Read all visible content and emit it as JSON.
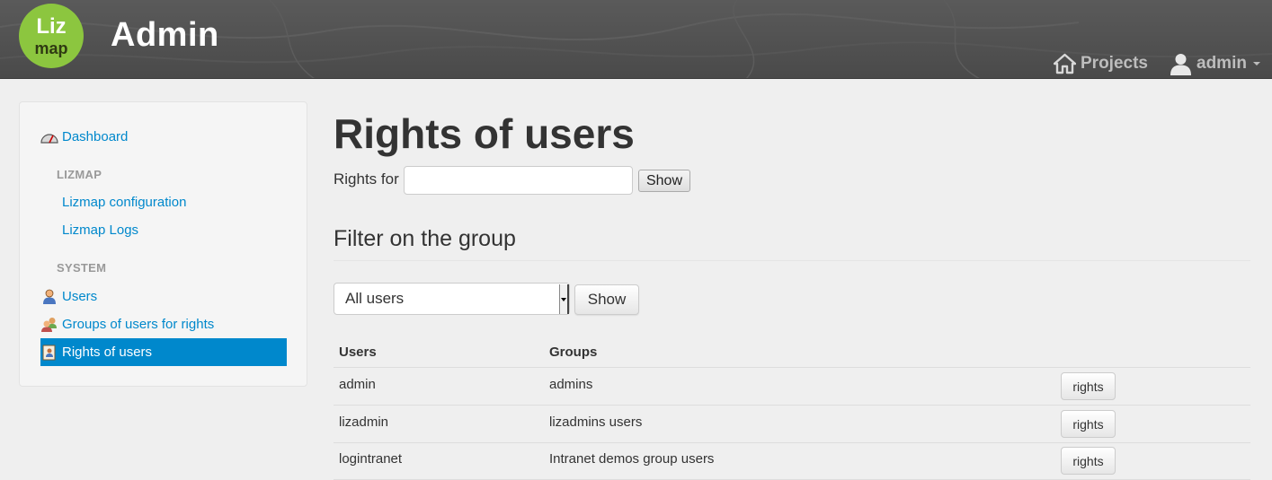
{
  "header": {
    "brand": "Admin",
    "logo_text_top": "Liz",
    "logo_text_bottom": "map",
    "projects_label": "Projects",
    "user_label": "admin"
  },
  "sidebar": {
    "dashboard": "Dashboard",
    "section_lizmap": "LIZMAP",
    "lizmap_configuration": "Lizmap configuration",
    "lizmap_logs": "Lizmap Logs",
    "section_system": "SYSTEM",
    "users": "Users",
    "groups": "Groups of users for rights",
    "rights": "Rights of users"
  },
  "main": {
    "title": "Rights of users",
    "rights_for_label": "Rights for",
    "rights_for_value": "",
    "show_button": "Show",
    "filter_title": "Filter on the group",
    "group_select_value": "All users",
    "filter_show_button": "Show",
    "table": {
      "headers": [
        "Users",
        "Groups"
      ],
      "rows": [
        {
          "user": "admin",
          "groups": "admins",
          "action": "rights"
        },
        {
          "user": "lizadmin",
          "groups": "lizadmins users",
          "action": "rights"
        },
        {
          "user": "logintranet",
          "groups": "Intranet demos group users",
          "action": "rights"
        }
      ]
    }
  },
  "colors": {
    "accent": "#0088cc",
    "header_bg": "#4a4a4a",
    "logo_green": "#8cc63f"
  }
}
